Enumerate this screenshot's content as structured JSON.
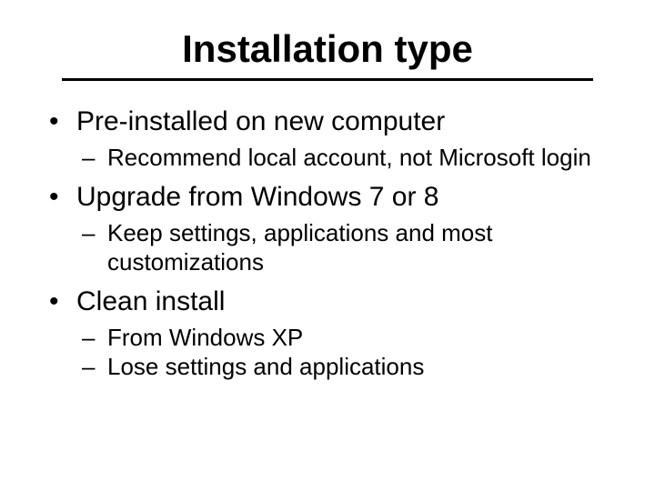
{
  "title": "Installation type",
  "items": [
    {
      "text": "Pre-installed on new computer",
      "sub": [
        "Recommend local account, not Microsoft login"
      ]
    },
    {
      "text": "Upgrade from Windows 7 or 8",
      "sub": [
        "Keep settings, applications and most customizations"
      ]
    },
    {
      "text": "Clean install",
      "sub": [
        "From Windows XP",
        "Lose settings and applications"
      ]
    }
  ]
}
